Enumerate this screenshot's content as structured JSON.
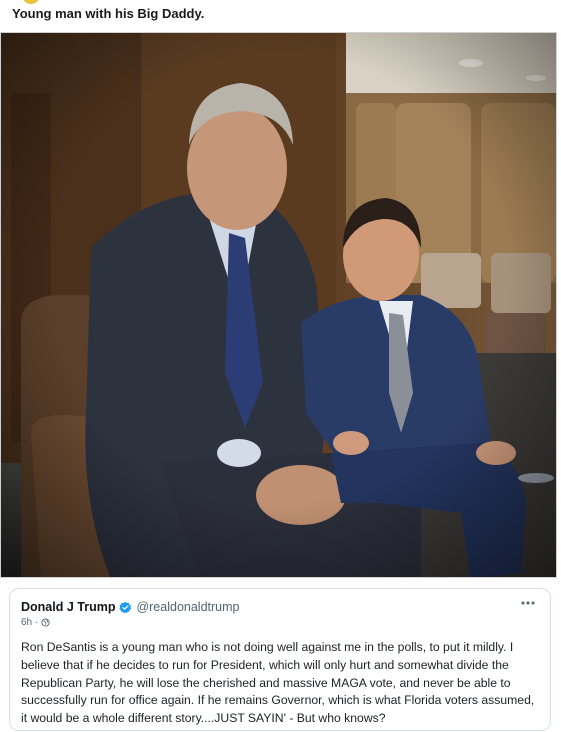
{
  "post": {
    "caption": "Young man with his Big Daddy."
  },
  "photo": {
    "alt": "photo",
    "colors": {
      "wall_dark": "#3b2a1b",
      "wood": "#6b4a2c",
      "suit_gray": "#2f3340",
      "suit_blue": "#27375e",
      "chair_leather": "#5a3f2a",
      "skin": "#c99a7c"
    }
  },
  "tweet": {
    "author_name": "Donald J Trump",
    "verified_icon": "verified-badge-icon",
    "handle": "@realdonaldtrump",
    "time": "6h",
    "separator": "·",
    "audience_icon": "globe-icon",
    "more_icon": "more-dots-icon",
    "body": "Ron DeSantis is a young man who is not doing well against me in the polls, to put it mildly. I believe that if he decides to run for President, which will only hurt and somewhat divide the Republican Party, he will lose the cherished and massive MAGA vote, and never be able to successfully run for office again. If he remains Governor, which is what Florida voters assumed, it would be a whole different story....JUST SAYIN' - But who knows?",
    "accent_color": "#1d9bf0"
  }
}
